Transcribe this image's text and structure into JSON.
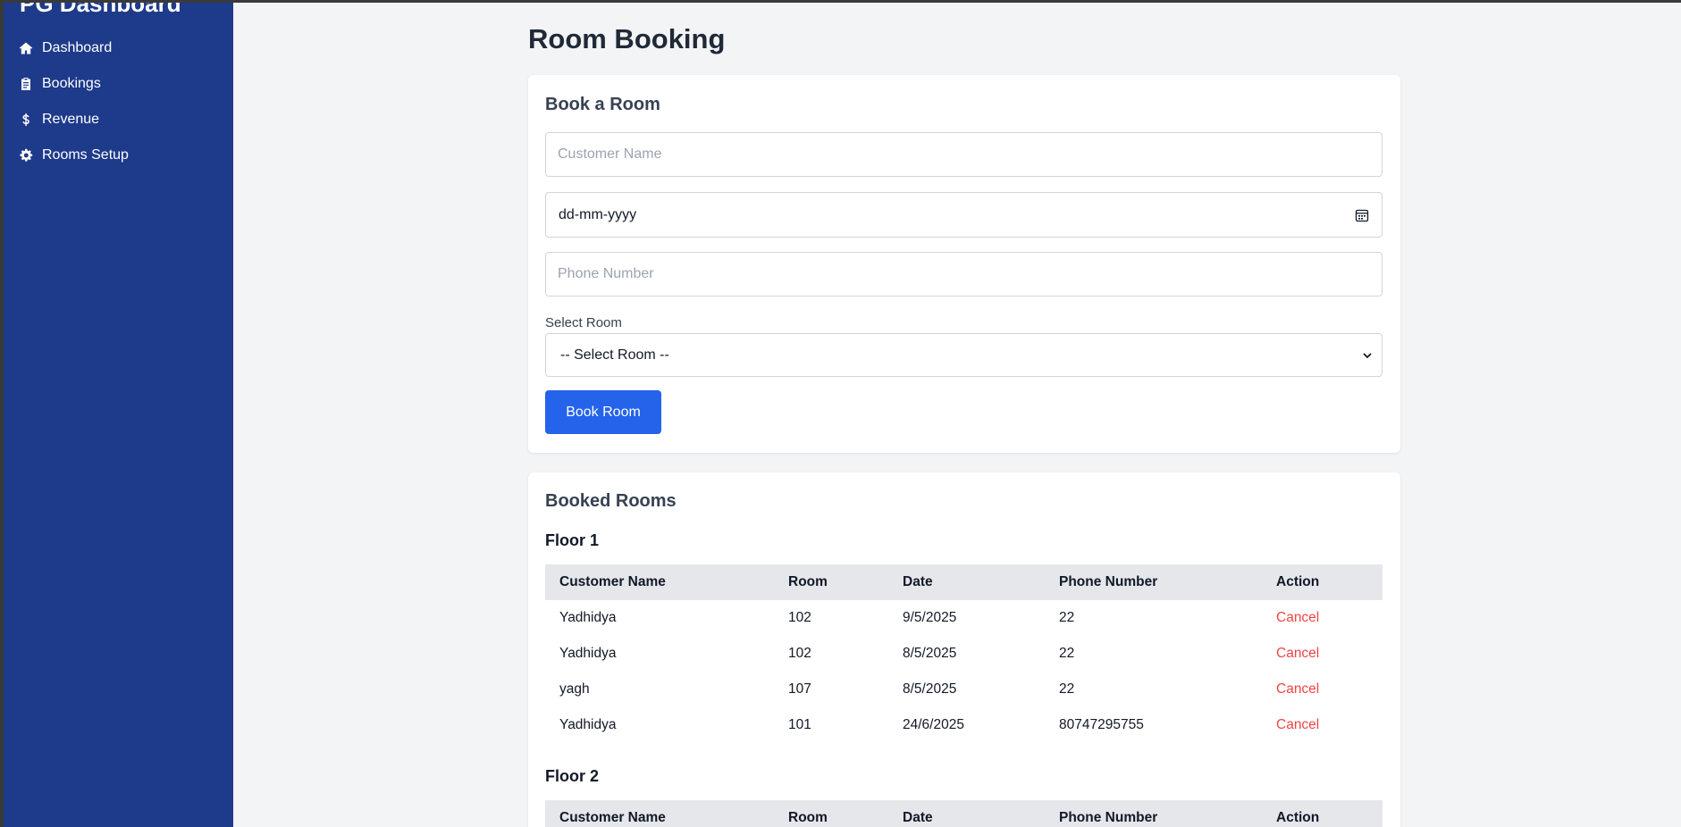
{
  "sidebar": {
    "brand": "PG Dashboard",
    "items": [
      {
        "label": "Dashboard",
        "icon": "home-icon"
      },
      {
        "label": "Bookings",
        "icon": "clipboard-icon"
      },
      {
        "label": "Revenue",
        "icon": "dollar-icon"
      },
      {
        "label": "Rooms Setup",
        "icon": "gear-icon"
      }
    ]
  },
  "main": {
    "title": "Room Booking",
    "book_form": {
      "title": "Book a Room",
      "customer_placeholder": "Customer Name",
      "date_value": "dd-mm-yyyy",
      "phone_placeholder": "Phone Number",
      "room_label": "Select Room",
      "room_selected": "-- Select Room --",
      "submit_label": "Book Room"
    },
    "booked": {
      "title": "Booked Rooms",
      "columns": [
        "Customer Name",
        "Room",
        "Date",
        "Phone Number",
        "Action"
      ],
      "floors": [
        {
          "name": "Floor 1",
          "rows": [
            {
              "customer": "Yadhidya",
              "room": "102",
              "date": "9/5/2025",
              "phone": "22",
              "action": "Cancel"
            },
            {
              "customer": "Yadhidya",
              "room": "102",
              "date": "8/5/2025",
              "phone": "22",
              "action": "Cancel"
            },
            {
              "customer": "yagh",
              "room": "107",
              "date": "8/5/2025",
              "phone": "22",
              "action": "Cancel"
            },
            {
              "customer": "Yadhidya",
              "room": "101",
              "date": "24/6/2025",
              "phone": "80747295755",
              "action": "Cancel"
            }
          ]
        },
        {
          "name": "Floor 2",
          "rows": []
        }
      ]
    }
  },
  "colors": {
    "sidebar_bg": "#1e3a8a",
    "primary": "#2563eb",
    "danger": "#ef4444",
    "page_bg": "#f3f4f6"
  }
}
